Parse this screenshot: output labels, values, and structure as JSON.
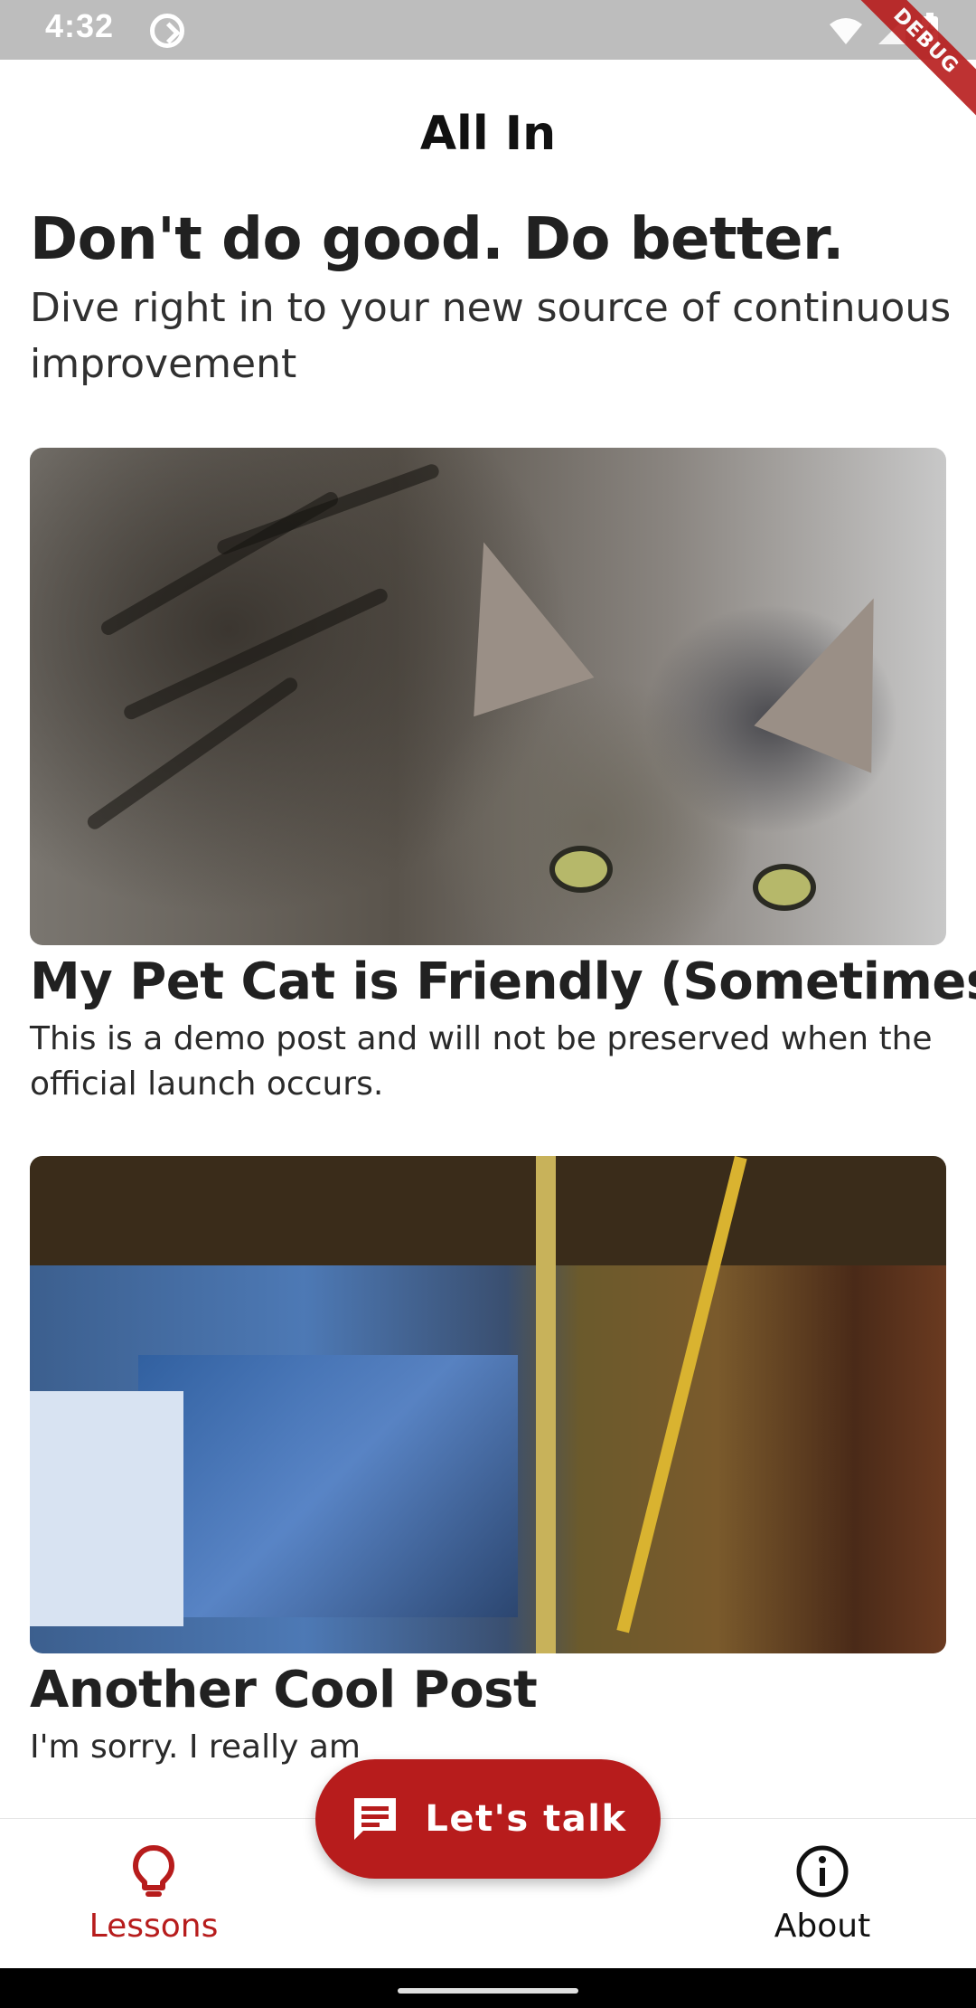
{
  "status_bar": {
    "time": "4:32",
    "debug_label": "DEBUG",
    "icons": [
      "app-notification-icon",
      "wifi-icon",
      "signal-icon",
      "battery-charging-icon"
    ]
  },
  "app_bar": {
    "title": "All In"
  },
  "hero": {
    "title": "Don't do good. Do better.",
    "subtitle": "Dive right in to your new source of continuous improvement"
  },
  "posts": [
    {
      "title": "My Pet Cat is Friendly (Sometimes)",
      "body": "This is a demo post and will not be preserved when the official launch occurs.",
      "image": "cat-photo"
    },
    {
      "title": "Another Cool Post",
      "body": "I'm sorry. I really am",
      "image": "desk-photo"
    }
  ],
  "fab": {
    "label": "Let's talk",
    "icon": "chat-icon"
  },
  "bottom_nav": {
    "items": [
      {
        "label": "Lessons",
        "icon": "lightbulb-icon",
        "selected": true
      },
      {
        "label": "About",
        "icon": "info-icon",
        "selected": false
      }
    ]
  },
  "colors": {
    "accent": "#b71c1c",
    "status_bar": "#bdbdbd",
    "text": "#212121"
  }
}
